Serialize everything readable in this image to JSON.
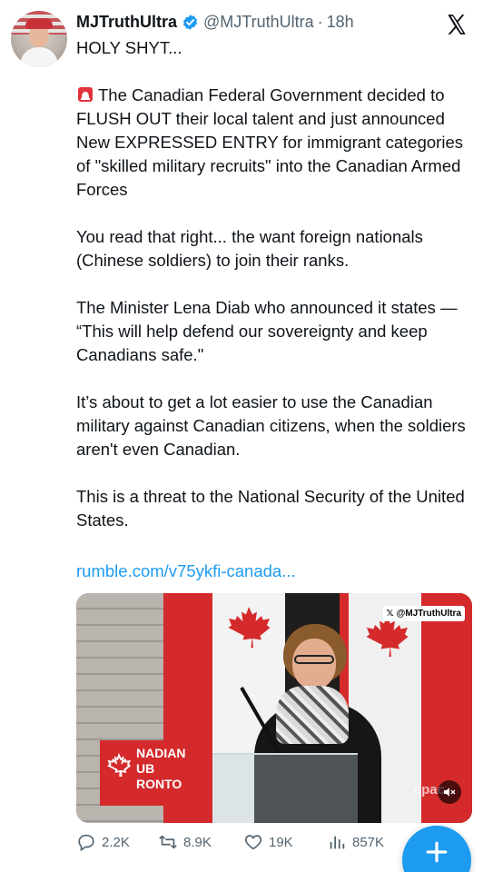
{
  "author": {
    "display_name": "MJTruthUltra",
    "handle": "@MJTruthUltra",
    "separator": "·",
    "time": "18h"
  },
  "tweet": {
    "lines": [
      "HOLY SHYT...",
      "The Canadian Federal Government decided to FLUSH OUT their local talent and just announced New EXPRESSED ENTRY for immigrant categories of \"skilled military recruits\" into the Canadian Armed Forces",
      "You read that right... the want foreign nationals (Chinese soldiers) to join their ranks.",
      "The Minister Lena Diab who announced it states — “This will help defend our sovereignty and keep Canadians safe.\"",
      "It’s about to get a lot easier to use the Canadian military against Canadian citizens, when the soldiers aren't even Canadian.",
      "This is a threat to the National Security of the United States."
    ],
    "link": "rumble.com/v75ykfi-canada..."
  },
  "media": {
    "watermark": "@MJTruthUltra",
    "sign_text": "NADIAN\nUB\nRONTO",
    "channel_mark": "cpac"
  },
  "actions": {
    "replies": "2.2K",
    "reposts": "8.9K",
    "likes": "19K",
    "views": "857K"
  },
  "colors": {
    "accent": "#1d9bf0",
    "text": "#0f1419",
    "muted": "#536471",
    "flag_red": "#d42a2c"
  },
  "icons": {
    "verified": "verified-badge-icon",
    "close": "x-logo-icon",
    "siren": "siren-emoji-icon",
    "reply": "reply-icon",
    "repost": "repost-icon",
    "like": "heart-icon",
    "views": "views-icon",
    "compose": "plus-icon",
    "mute": "muted-speaker-icon"
  }
}
